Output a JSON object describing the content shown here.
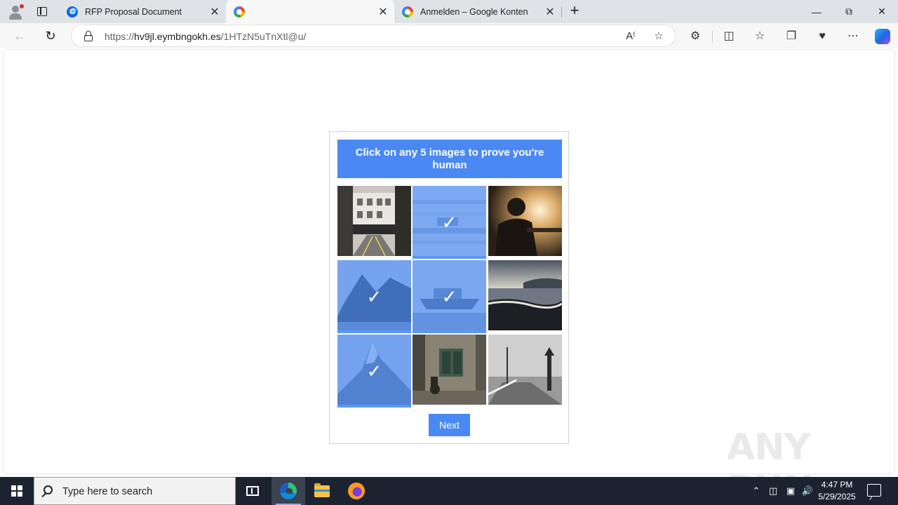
{
  "browser": {
    "tabs": [
      {
        "title": "RFP Proposal Document",
        "favicon": "copilot-c-icon"
      },
      {
        "title": "",
        "favicon": "google-g-icon",
        "active": true
      },
      {
        "title": "Anmelden – Google Konten",
        "favicon": "google-g-icon"
      }
    ],
    "address": {
      "scheme": "https://",
      "host": "hv9jl.eymbngokh.es",
      "path": "/1HTzN5uTnXtl@u/"
    }
  },
  "captcha": {
    "prompt": "Click on any 5 images to prove you're human",
    "tiles": [
      {
        "scene": "street-buildings",
        "selected": false
      },
      {
        "scene": "blurred-boat",
        "selected": true
      },
      {
        "scene": "person-sunset",
        "selected": false
      },
      {
        "scene": "rocky-island",
        "selected": true
      },
      {
        "scene": "ship-in-fog",
        "selected": true
      },
      {
        "scene": "beach-waves",
        "selected": false
      },
      {
        "scene": "mountain-peak",
        "selected": true
      },
      {
        "scene": "old-building-cyclist",
        "selected": false
      },
      {
        "scene": "pier-lighthouse",
        "selected": false
      }
    ],
    "check_glyph": "✓",
    "next_label": "Next"
  },
  "watermark": "ANY RUN",
  "taskbar": {
    "search_placeholder": "Type here to search",
    "time": "4:47 PM",
    "date": "5/29/2025"
  },
  "colors": {
    "accent": "#4a89f3",
    "taskbar": "#1c2330",
    "tabstrip": "#dfe3e8"
  }
}
